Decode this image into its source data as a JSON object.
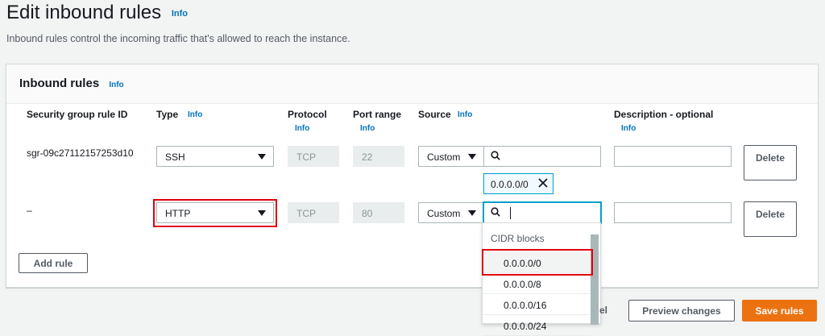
{
  "page": {
    "title": "Edit inbound rules",
    "title_info": "Info",
    "description": "Inbound rules control the incoming traffic that's allowed to reach the instance."
  },
  "panel": {
    "title": "Inbound rules",
    "title_info": "Info",
    "columns": {
      "rule_id": "Security group rule ID",
      "type": "Type",
      "type_info": "Info",
      "protocol": "Protocol",
      "protocol_info": "Info",
      "port_range": "Port range",
      "port_info": "Info",
      "source": "Source",
      "source_info": "Info",
      "description": "Description - optional",
      "description_info": "Info"
    },
    "rows": [
      {
        "rule_id": "sgr-09c27112157253d10",
        "type": "SSH",
        "protocol": "TCP",
        "port": "22",
        "source_type": "Custom",
        "token": "0.0.0.0/0",
        "delete_label": "Delete"
      },
      {
        "rule_id": "–",
        "type": "HTTP",
        "protocol": "TCP",
        "port": "80",
        "source_type": "Custom",
        "delete_label": "Delete"
      }
    ],
    "add_rule_label": "Add rule"
  },
  "dropdown": {
    "group_label": "CIDR blocks",
    "options": [
      "0.0.0.0/0",
      "0.0.0.0/8",
      "0.0.0.0/16",
      "0.0.0.0/24"
    ]
  },
  "footer": {
    "cancel_label": "el",
    "preview_label": "Preview changes",
    "save_label": "Save rules"
  },
  "colors": {
    "link": "#0073bb",
    "primary": "#ec7211",
    "highlight": "#e0000f",
    "focus": "#00a1c9"
  }
}
